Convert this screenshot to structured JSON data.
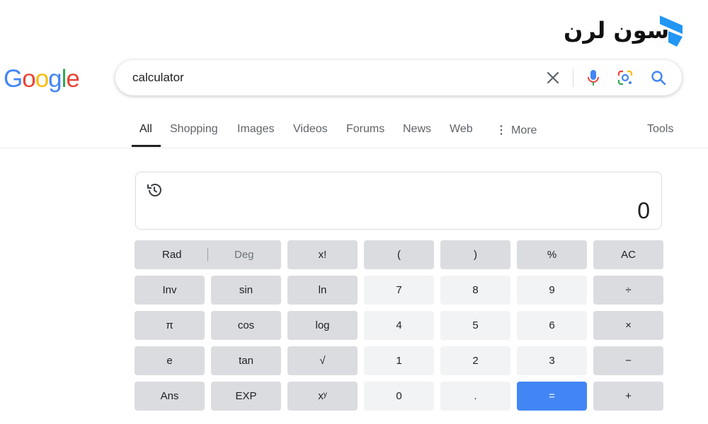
{
  "watermark": {
    "text": "سون لرن"
  },
  "logo": {
    "letters": [
      "G",
      "o",
      "o",
      "g",
      "l",
      "e"
    ],
    "colors": [
      "#4285f4",
      "#ea4335",
      "#fbbc05",
      "#4285f4",
      "#34a853",
      "#ea4335"
    ]
  },
  "search": {
    "query": "calculator"
  },
  "icons": {
    "clear": "close-icon",
    "mic": "mic-icon",
    "lens": "lens-icon",
    "search": "search-icon",
    "history": "history-icon"
  },
  "tabs": [
    {
      "label": "All",
      "active": true
    },
    {
      "label": "Shopping"
    },
    {
      "label": "Images"
    },
    {
      "label": "Videos"
    },
    {
      "label": "Forums"
    },
    {
      "label": "News"
    },
    {
      "label": "Web"
    },
    {
      "label": "More"
    },
    {
      "label": "Tools"
    }
  ],
  "calculator": {
    "display": "0",
    "rad_label": "Rad",
    "deg_label": "Deg",
    "keys": [
      "x!",
      "(",
      ")",
      "%",
      "AC",
      "Inv",
      "sin",
      "ln",
      "7",
      "8",
      "9",
      "÷",
      "π",
      "cos",
      "log",
      "4",
      "5",
      "6",
      "×",
      "e",
      "tan",
      "√",
      "1",
      "2",
      "3",
      "−",
      "Ans",
      "EXP",
      "xʸ",
      "0",
      ".",
      "=",
      "+"
    ]
  },
  "colors": {
    "accent": "#4285f4",
    "fn_key": "#dadce0",
    "num_key": "#f1f3f4",
    "watermark_blue": "#2196f3"
  }
}
